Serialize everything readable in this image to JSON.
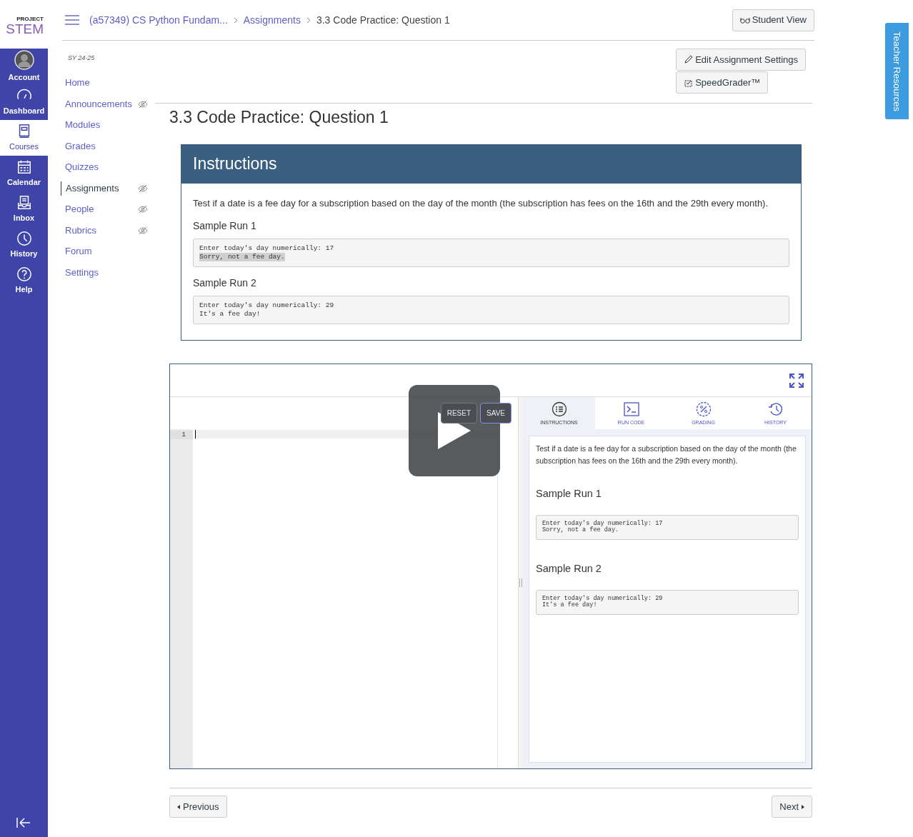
{
  "logo": {
    "small": "PROJECT",
    "big": "STEM"
  },
  "global_nav": [
    {
      "label": "Account",
      "kind": "avatar",
      "selected": false
    },
    {
      "label": "Dashboard",
      "kind": "dashboard",
      "selected": false
    },
    {
      "label": "Courses",
      "kind": "courses",
      "selected": true
    },
    {
      "label": "Calendar",
      "kind": "calendar",
      "selected": false
    },
    {
      "label": "Inbox",
      "kind": "inbox",
      "selected": false
    },
    {
      "label": "History",
      "kind": "history",
      "selected": false
    },
    {
      "label": "Help",
      "kind": "help",
      "selected": false
    }
  ],
  "breadcrumbs": [
    {
      "label": "(a57349) CS Python Fundam...",
      "kind": "link"
    },
    {
      "label": "Assignments",
      "kind": "link"
    },
    {
      "label": "3.3 Code Practice: Question 1",
      "kind": "current"
    }
  ],
  "student_view_button": "Student View",
  "course_nav": {
    "term": "SY 24-25",
    "items": [
      {
        "label": "Home",
        "hidden": false,
        "selected": false
      },
      {
        "label": "Announcements",
        "hidden": true,
        "selected": false
      },
      {
        "label": "Modules",
        "hidden": false,
        "selected": false
      },
      {
        "label": "Grades",
        "hidden": false,
        "selected": false
      },
      {
        "label": "Quizzes",
        "hidden": false,
        "selected": false
      },
      {
        "label": "Assignments",
        "hidden": true,
        "selected": true
      },
      {
        "label": "People",
        "hidden": true,
        "selected": false
      },
      {
        "label": "Rubrics",
        "hidden": true,
        "selected": false
      },
      {
        "label": "Forum",
        "hidden": false,
        "selected": false
      },
      {
        "label": "Settings",
        "hidden": false,
        "selected": false
      }
    ]
  },
  "actions": [
    {
      "label": "Edit Assignment Settings",
      "kind": "edit"
    },
    {
      "label": "SpeedGrader™",
      "kind": "grader"
    }
  ],
  "page_title": "3.3 Code Practice: Question 1",
  "instructions": {
    "heading": "Instructions",
    "text": "Test if a date is a fee day for a subscription based on the day of the month (the subscription has fees on the 16th and the 29th every month).",
    "samples": [
      {
        "title": "Sample Run 1",
        "lines": [
          {
            "text": "Enter today's day numerically: 17",
            "highlighted": false
          },
          {
            "text": "Sorry, not a fee day.",
            "highlighted": true
          }
        ]
      },
      {
        "title": "Sample Run 2",
        "lines": [
          {
            "text": "Enter today's day numerically: 29",
            "highlighted": false
          },
          {
            "text": "It's a fee day!",
            "highlighted": false
          }
        ]
      }
    ]
  },
  "editor": {
    "buttons": [
      "RESET",
      "SAVE"
    ],
    "line_numbers": [
      "1"
    ],
    "tabs": [
      {
        "label": "INSTRUCTIONS",
        "kind": "instructions",
        "selected": true
      },
      {
        "label": "RUN CODE",
        "kind": "terminal",
        "selected": false
      },
      {
        "label": "GRADING",
        "kind": "grading",
        "selected": false
      },
      {
        "label": "HISTORY",
        "kind": "history",
        "selected": false
      }
    ],
    "panel": {
      "text": "Test if a date is a fee day for a subscription based on the day of the month (the subscription has fees on the 16th and the 29th every month).",
      "samples": [
        {
          "title": "Sample Run 1",
          "lines": [
            "Enter today's day numerically: 17",
            "Sorry, not a fee day."
          ]
        },
        {
          "title": "Sample Run 2",
          "lines": [
            "Enter today's day numerically: 29",
            "It's a fee day!"
          ]
        }
      ]
    }
  },
  "pager": {
    "previous": "Previous",
    "next": "Next"
  },
  "teacher_resources": "Teacher Resources"
}
